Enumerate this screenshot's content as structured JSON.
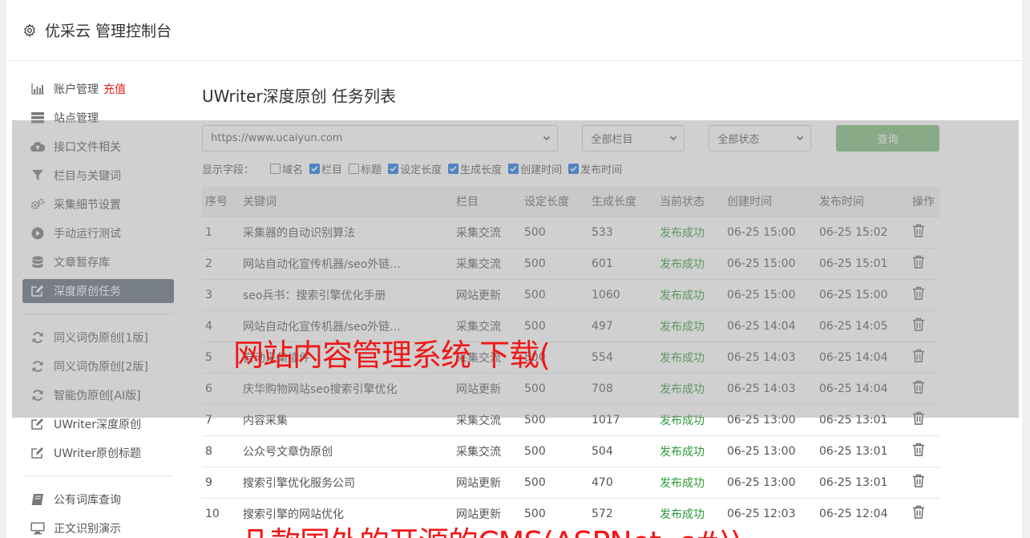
{
  "app": {
    "title": "优采云 管理控制台"
  },
  "sidebar": {
    "group1": [
      {
        "label": "账户管理",
        "badge": "充值",
        "icon": "bar-chart-icon"
      },
      {
        "label": "站点管理",
        "icon": "server-icon"
      },
      {
        "label": "接口文件相关",
        "icon": "cloud-upload-icon"
      },
      {
        "label": "栏目与关键词",
        "icon": "filter-icon"
      },
      {
        "label": "采集细节设置",
        "icon": "gears-icon"
      },
      {
        "label": "手动运行测试",
        "icon": "play-circle-icon"
      },
      {
        "label": "文章暂存库",
        "icon": "database-icon"
      },
      {
        "label": "深度原创任务",
        "icon": "edit-icon",
        "active": true
      }
    ],
    "group2": [
      {
        "label": "同义词伪原创[1版]",
        "icon": "refresh-icon"
      },
      {
        "label": "同义词伪原创[2版]",
        "icon": "refresh-icon"
      },
      {
        "label": "智能伪原创[AI版]",
        "icon": "refresh-icon"
      },
      {
        "label": "UWriter深度原创",
        "icon": "edit-icon"
      },
      {
        "label": "UWriter原创标题",
        "icon": "edit-icon"
      }
    ],
    "group3": [
      {
        "label": "公有词库查询",
        "icon": "book-icon"
      },
      {
        "label": "正文识别演示",
        "icon": "monitor-icon"
      }
    ]
  },
  "main": {
    "title": "UWriter深度原创 任务列表",
    "filters": {
      "site": "https://www.ucaiyun.com",
      "column": "全部栏目",
      "status": "全部状态",
      "query_label": "查询"
    },
    "fields": {
      "label": "显示字段：",
      "items": [
        {
          "label": "域名",
          "checked": false
        },
        {
          "label": "栏目",
          "checked": true
        },
        {
          "label": "标题",
          "checked": false
        },
        {
          "label": "设定长度",
          "checked": true
        },
        {
          "label": "生成长度",
          "checked": true
        },
        {
          "label": "创建时间",
          "checked": true
        },
        {
          "label": "发布时间",
          "checked": true
        }
      ]
    },
    "table": {
      "headers": [
        "序号",
        "关键词",
        "栏目",
        "设定长度",
        "生成长度",
        "当前状态",
        "创建时间",
        "发布时间",
        "操作"
      ],
      "rows": [
        [
          "1",
          "采集器的自动识别算法",
          "采集交流",
          "500",
          "533",
          "发布成功",
          "06-25 15:00",
          "06-25 15:02"
        ],
        [
          "2",
          "网站自动化宣传机器/seo外链...",
          "采集交流",
          "500",
          "601",
          "发布成功",
          "06-25 15:00",
          "06-25 15:01"
        ],
        [
          "3",
          "seo兵书：搜索引擎优化手册",
          "网站更新",
          "500",
          "1060",
          "发布成功",
          "06-25 15:00",
          "06-25 15:00"
        ],
        [
          "4",
          "网站自动化宣传机器/seo外链...",
          "采集交流",
          "500",
          "497",
          "发布成功",
          "06-25 14:04",
          "06-25 14:05"
        ],
        [
          "5",
          "自动采集插件",
          "采集交流",
          "500",
          "554",
          "发布成功",
          "06-25 14:03",
          "06-25 14:04"
        ],
        [
          "6",
          "庆华购物网站seo搜索引擎优化",
          "网站更新",
          "500",
          "708",
          "发布成功",
          "06-25 14:03",
          "06-25 14:04"
        ],
        [
          "7",
          "内容采集",
          "采集交流",
          "500",
          "1017",
          "发布成功",
          "06-25 13:00",
          "06-25 13:01"
        ],
        [
          "8",
          "公众号文章伪原创",
          "采集交流",
          "500",
          "504",
          "发布成功",
          "06-25 13:00",
          "06-25 13:01"
        ],
        [
          "9",
          "搜索引擎优化服务公司",
          "网站更新",
          "500",
          "470",
          "发布成功",
          "06-25 13:00",
          "06-25 13:01"
        ],
        [
          "10",
          "搜索引擎的网站优化",
          "网站更新",
          "500",
          "572",
          "发布成功",
          "06-25 12:03",
          "06-25 12:04"
        ]
      ]
    }
  },
  "watermark": {
    "line1": "网站内容管理系统 下载(",
    "line2": "几款国外的开源的CMS(ASPNet, c#))"
  },
  "colors": {
    "active_nav": "#5f6a7d",
    "query_button": "#7dbb7b",
    "success": "#2e9a38",
    "watermark": "#f01818",
    "badge": "#e02020"
  }
}
